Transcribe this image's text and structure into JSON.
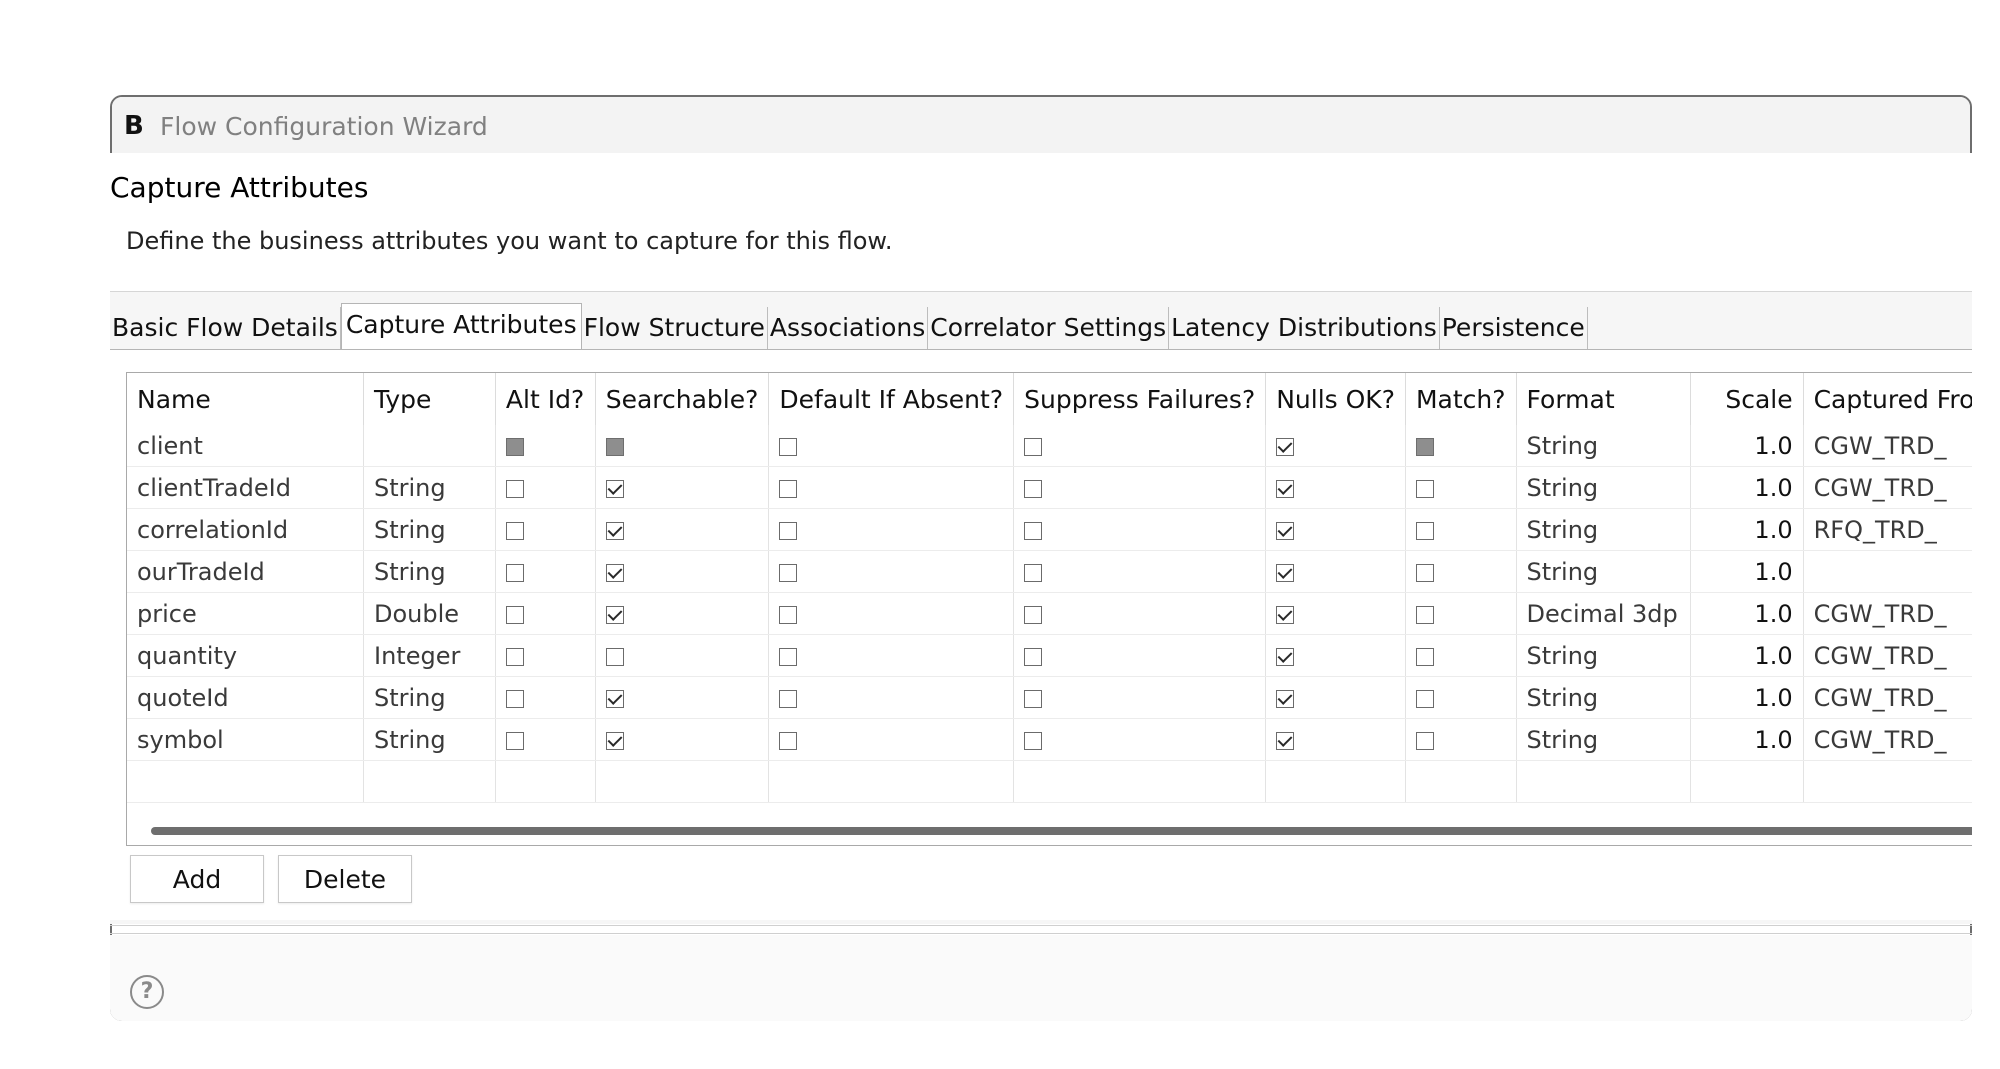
{
  "window": {
    "title": "Flow Configuration Wizard",
    "logo_text": "B"
  },
  "page": {
    "title": "Capture Attributes",
    "description": "Define the business attributes you want to capture for this flow."
  },
  "tabs": [
    {
      "label": "Basic Flow Details",
      "active": false
    },
    {
      "label": "Capture Attributes",
      "active": true
    },
    {
      "label": "Flow Structure",
      "active": false
    },
    {
      "label": "Associations",
      "active": false
    },
    {
      "label": "Correlator Settings",
      "active": false
    },
    {
      "label": "Latency Distributions",
      "active": false
    },
    {
      "label": "Persistence",
      "active": false
    }
  ],
  "table": {
    "columns": [
      "Name",
      "Type",
      "Alt Id?",
      "Searchable?",
      "Default If Absent?",
      "Suppress Failures?",
      "Nulls OK?",
      "Match?",
      "Format",
      "Scale",
      "Captured Fro"
    ],
    "rows": [
      {
        "name": "client",
        "type": "",
        "alt_id": "disabled",
        "searchable": "disabled",
        "default_if_absent": "unchecked",
        "suppress_failures": "unchecked",
        "nulls_ok": "checked",
        "match": "disabled",
        "format": "String",
        "scale": "1.0",
        "captured_from": "CGW_TRD_"
      },
      {
        "name": "clientTradeId",
        "type": "String",
        "alt_id": "unchecked",
        "searchable": "checked",
        "default_if_absent": "unchecked",
        "suppress_failures": "unchecked",
        "nulls_ok": "checked",
        "match": "unchecked",
        "format": "String",
        "scale": "1.0",
        "captured_from": "CGW_TRD_"
      },
      {
        "name": "correlationId",
        "type": "String",
        "alt_id": "unchecked",
        "searchable": "checked",
        "default_if_absent": "unchecked",
        "suppress_failures": "unchecked",
        "nulls_ok": "checked",
        "match": "unchecked",
        "format": "String",
        "scale": "1.0",
        "captured_from": "RFQ_TRD_"
      },
      {
        "name": "ourTradeId",
        "type": "String",
        "alt_id": "unchecked",
        "searchable": "checked",
        "default_if_absent": "unchecked",
        "suppress_failures": "unchecked",
        "nulls_ok": "checked",
        "match": "unchecked",
        "format": "String",
        "scale": "1.0",
        "captured_from": ""
      },
      {
        "name": "price",
        "type": "Double",
        "alt_id": "unchecked",
        "searchable": "checked",
        "default_if_absent": "unchecked",
        "suppress_failures": "unchecked",
        "nulls_ok": "checked",
        "match": "unchecked",
        "format": "Decimal 3dp",
        "scale": "1.0",
        "captured_from": "CGW_TRD_"
      },
      {
        "name": "quantity",
        "type": "Integer",
        "alt_id": "unchecked",
        "searchable": "unchecked",
        "default_if_absent": "unchecked",
        "suppress_failures": "unchecked",
        "nulls_ok": "checked",
        "match": "unchecked",
        "format": "String",
        "scale": "1.0",
        "captured_from": "CGW_TRD_"
      },
      {
        "name": "quoteId",
        "type": "String",
        "alt_id": "unchecked",
        "searchable": "checked",
        "default_if_absent": "unchecked",
        "suppress_failures": "unchecked",
        "nulls_ok": "checked",
        "match": "unchecked",
        "format": "String",
        "scale": "1.0",
        "captured_from": "CGW_TRD_"
      },
      {
        "name": "symbol",
        "type": "String",
        "alt_id": "unchecked",
        "searchable": "checked",
        "default_if_absent": "unchecked",
        "suppress_failures": "unchecked",
        "nulls_ok": "checked",
        "match": "unchecked",
        "format": "String",
        "scale": "1.0",
        "captured_from": "CGW_TRD_"
      }
    ]
  },
  "buttons": {
    "add": "Add",
    "delete": "Delete"
  },
  "help": {
    "icon": "help-icon",
    "glyph": "?"
  }
}
